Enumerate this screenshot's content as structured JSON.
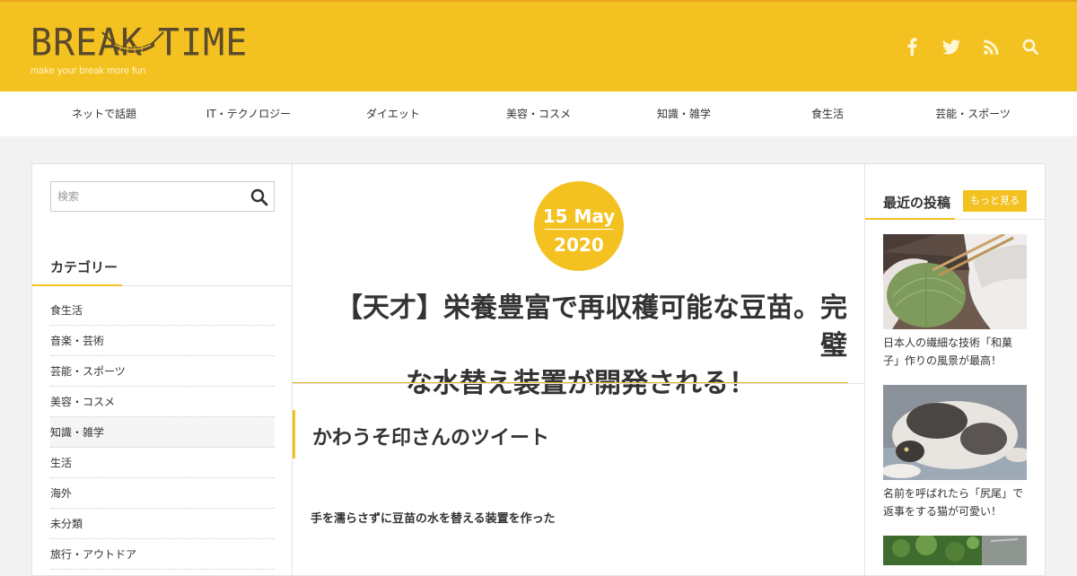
{
  "site": {
    "logo_left": "BREAK",
    "logo_right": "TIME",
    "tagline": "make your break more fun"
  },
  "social_icons": [
    "facebook-icon",
    "twitter-icon",
    "rss-icon",
    "search-icon"
  ],
  "nav": [
    "ネットで話題",
    "IT・テクノロジー",
    "ダイエット",
    "美容・コスメ",
    "知識・雑学",
    "食生活",
    "芸能・スポーツ"
  ],
  "sidebar": {
    "search_placeholder": "検索",
    "category_heading": "カテゴリー",
    "categories": [
      "食生活",
      "音楽・芸術",
      "芸能・スポーツ",
      "美容・コスメ",
      "知識・雑学",
      "生活",
      "海外",
      "未分類",
      "旅行・アウトドア"
    ]
  },
  "post": {
    "date_day": "15 May",
    "date_year": "2020",
    "title_line1": "【天才】栄養豊富で再収穫可能な豆苗。完璧",
    "title_line2": "な水替え装置が開発される！",
    "section_heading": "かわうそ印さんのツイート",
    "body": "手を濡らさずに豆苗の水を替える装置を作った"
  },
  "recent": {
    "heading": "最近の投稿",
    "more_label": "もっと見る",
    "items": [
      {
        "line1": "日本人の繊細な技術「和菓",
        "line2": "子」作りの風景が最高！"
      },
      {
        "line1": "名前を呼ばれたら「尻尾」で",
        "line2": "返事をする猫が可愛い！"
      }
    ]
  },
  "colors": {
    "accent": "#f3c221",
    "logo": "#5b4a2c",
    "page_bg": "#f2f2f2"
  }
}
